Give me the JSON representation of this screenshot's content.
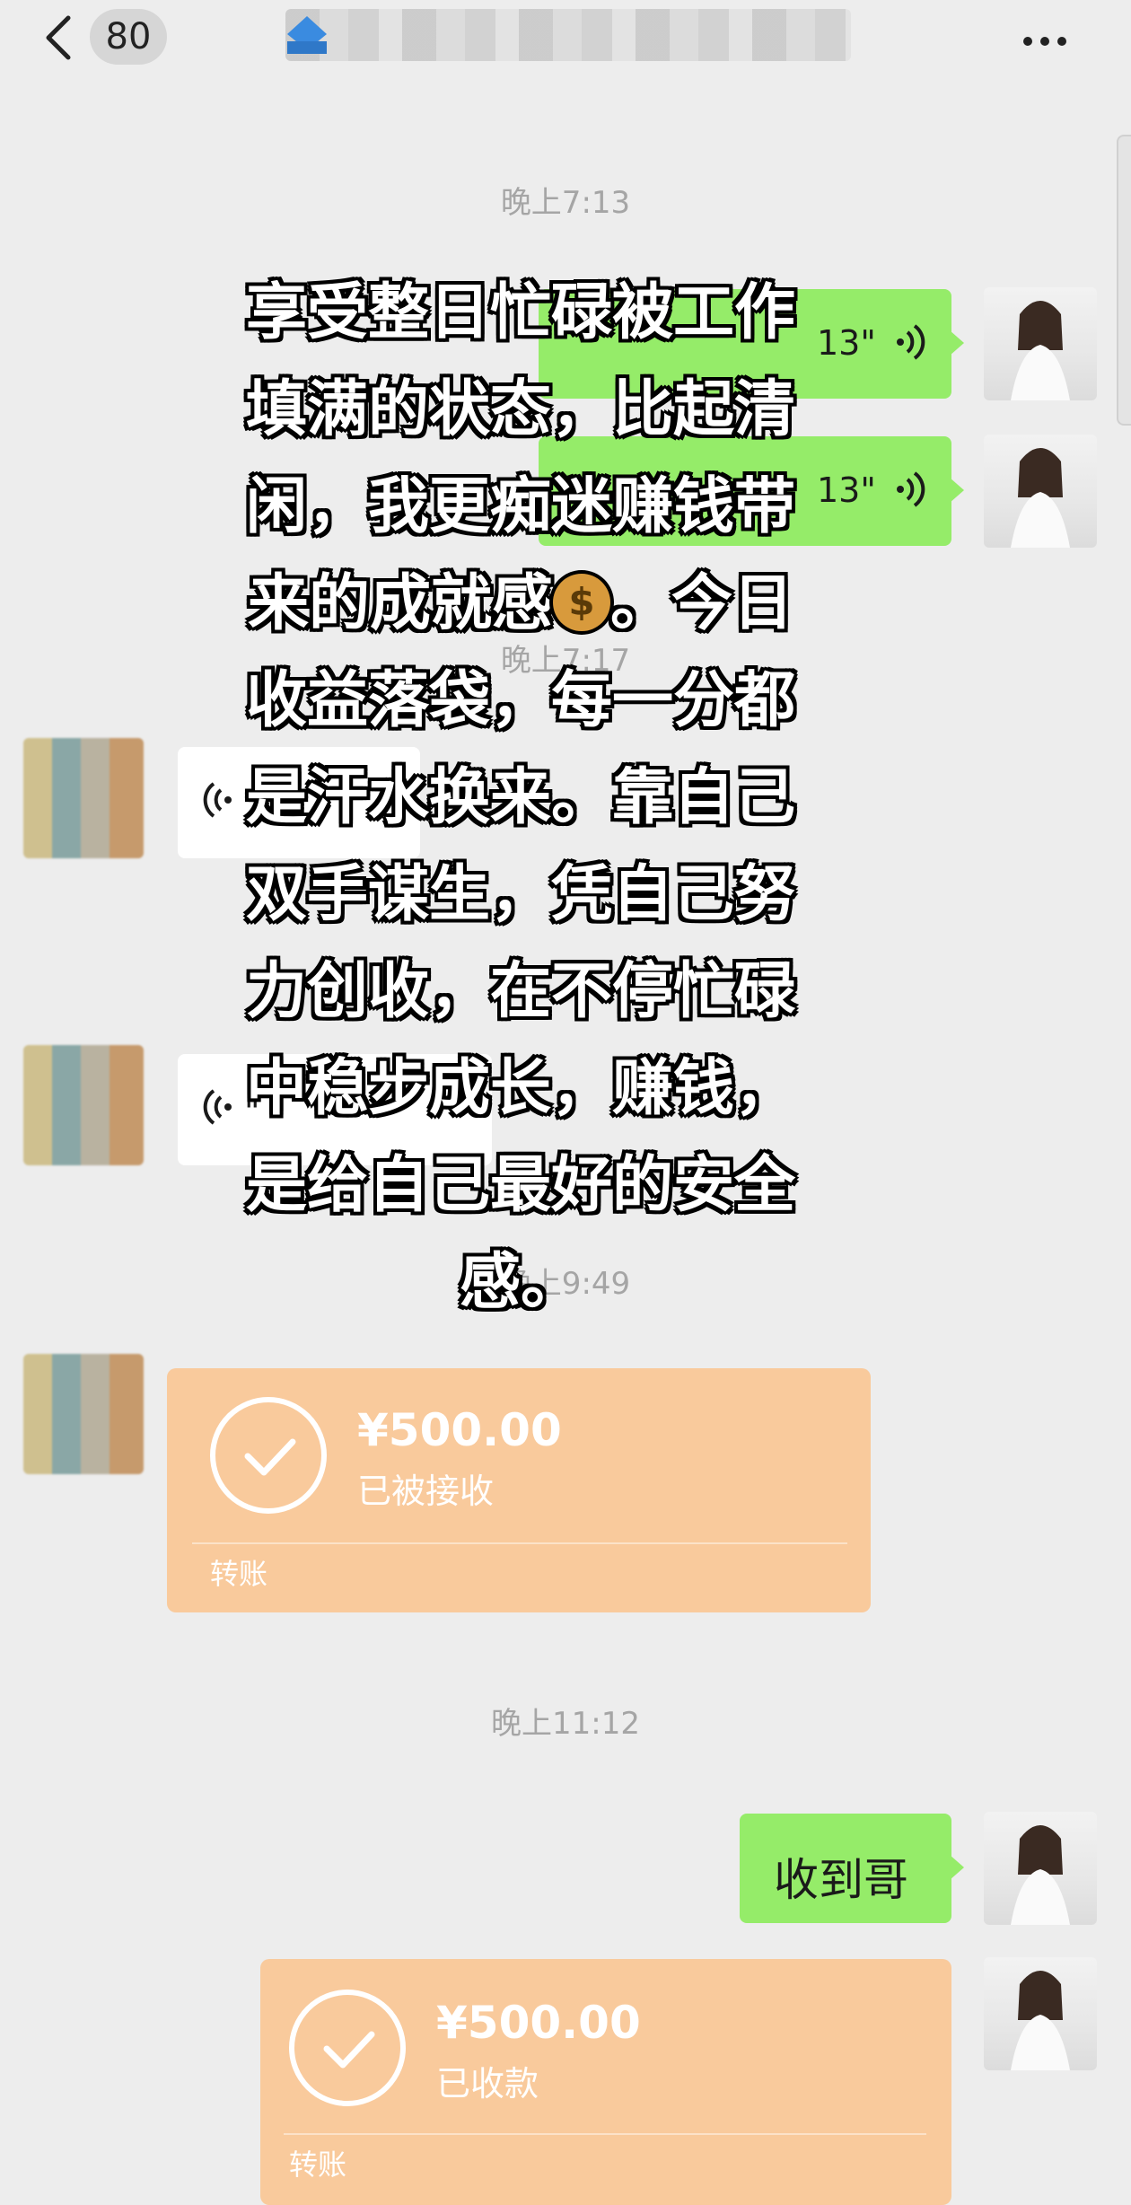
{
  "header": {
    "back_badge": "80"
  },
  "times": {
    "t1": "晚上7:13",
    "t2": "晚上7:17",
    "t3": "晚上9:49",
    "t4": "晚上11:12"
  },
  "messages": {
    "voice1_duration": "13\"",
    "voice2_duration": "13\"",
    "voice3_text": "\"",
    "reply_text": "收到哥"
  },
  "transfers": {
    "incoming": {
      "amount": "¥500.00",
      "status": "已被接收",
      "label": "转账"
    },
    "outgoing": {
      "amount": "¥500.00",
      "status": "已收款",
      "label": "转账"
    }
  },
  "caption": {
    "lines": [
      "享受整日忙碌被工作",
      "填满的状态，比起清",
      "闲，我更痴迷赚钱带",
      "来的成就感",
      "。今日",
      "收益落袋，每一分都",
      "是汗水换来。靠自己",
      "双手谋生，凭自己努",
      "力创收，在不停忙碌",
      "中稳步成长，赚钱，",
      "是给自己最好的安全",
      "感。"
    ]
  },
  "icons": {
    "back": "chevron-left-icon",
    "more": "more-dots-icon",
    "voice": "voice-wave-icon",
    "check": "check-circle-icon",
    "money": "money-bag-icon"
  },
  "colors": {
    "bubble_green": "#95ec69",
    "transfer_orange": "#f9ca9c",
    "background": "#ededed"
  }
}
